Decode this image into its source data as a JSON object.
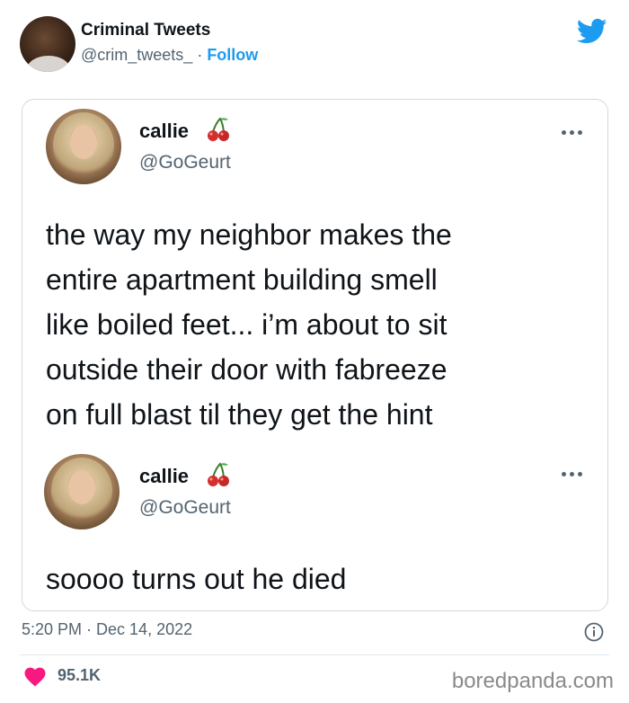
{
  "header": {
    "author_name": "Criminal Tweets",
    "author_handle": "@crim_tweets_",
    "separator": " · ",
    "follow_label": "Follow",
    "brand_icon": "twitter-bird-icon",
    "brand_color": "#1d9bf0"
  },
  "card": {
    "posts": [
      {
        "name": "callie",
        "handle": "@GoGeurt",
        "emoji": "cherry-icon",
        "text_lines": [
          "the way my neighbor makes the",
          "entire apartment building smell",
          "like boiled feet... i’m about to sit",
          "outside their door with fabreeze",
          "on full blast til they get the hint"
        ]
      },
      {
        "name": "callie",
        "handle": "@GoGeurt",
        "emoji": "cherry-icon",
        "text_lines": [
          "soooo turns out he died"
        ]
      }
    ]
  },
  "footer": {
    "timestamp": "5:20 PM · Dec 14, 2022",
    "likes": "95.1K",
    "like_color": "#f91880",
    "watermark": "boredpanda.com"
  }
}
